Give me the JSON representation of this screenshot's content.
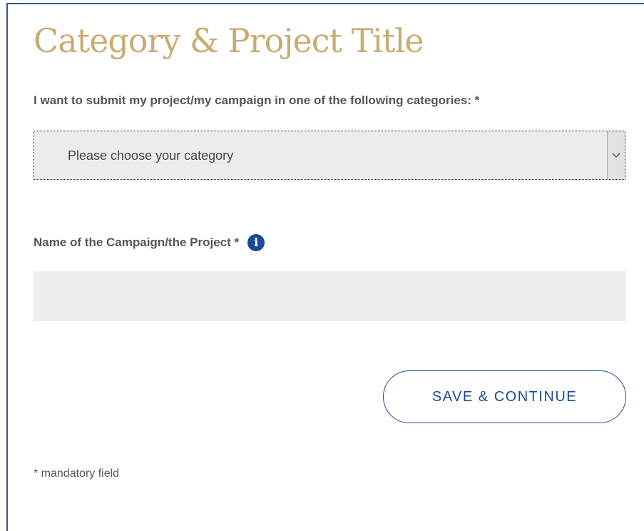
{
  "page": {
    "title": "Category & Project Title"
  },
  "category": {
    "label": "I want to submit my project/my campaign in one of the following categories: *",
    "selected": "Please choose your category"
  },
  "project_name": {
    "label": "Name of the Campaign/the Project *",
    "info_glyph": "i",
    "value": ""
  },
  "actions": {
    "save_label": "SAVE & CONTINUE"
  },
  "footnote": "* mandatory field",
  "colors": {
    "title": "#c9ab72",
    "accent": "#1a4a96",
    "field_background": "#ececec",
    "label": "#555555"
  },
  "icons": {
    "info": "info-icon",
    "dropdown": "chevron-down-icon"
  }
}
